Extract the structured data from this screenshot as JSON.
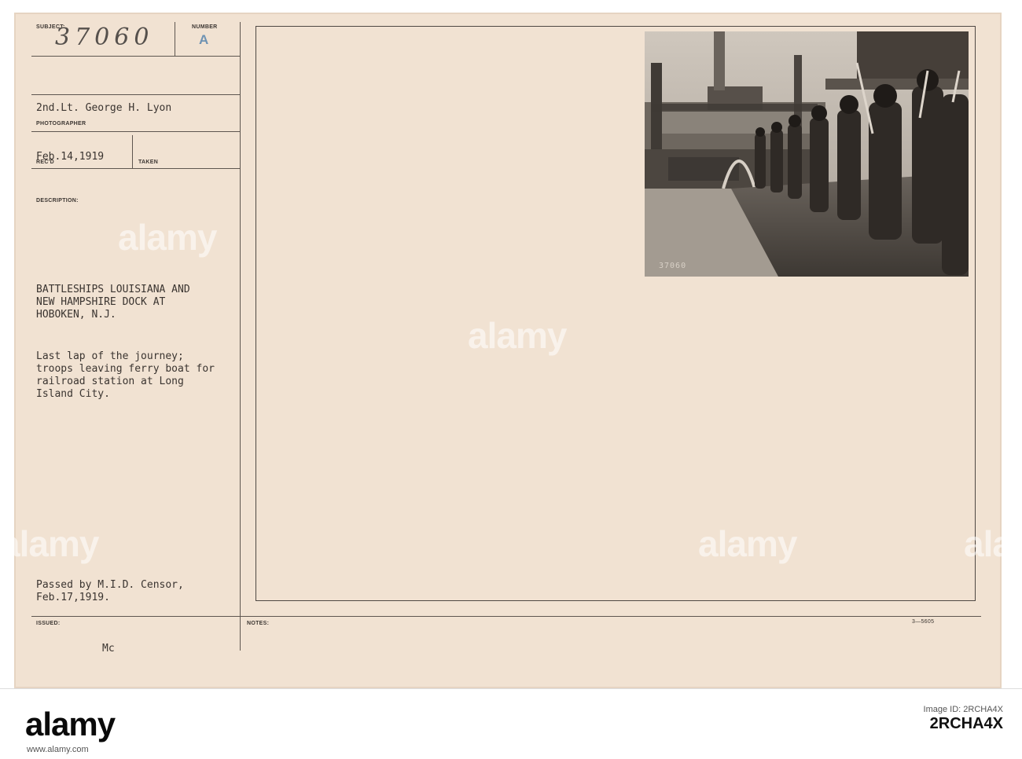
{
  "card": {
    "labels": {
      "subject": "SUBJECT:",
      "number": "NUMBER",
      "photographer": "PHOTOGRAPHER",
      "recd": "REC'D",
      "taken": "TAKEN",
      "description": "DESCRIPTION:",
      "issued": "ISSUED:",
      "notes": "NOTES:"
    },
    "subject_number": "37060",
    "number_letter": "A",
    "photographer": "2nd.Lt. George H. Lyon",
    "date_received": "Feb.14,1919",
    "description_title": "BATTLESHIPS LOUISIANA AND\nNEW HAMPSHIRE DOCK AT\nHOBOKEN, N.J.",
    "description_body": "Last lap of the journey;\ntroops leaving ferry boat for\nrailroad station at Long\nIsland City.",
    "censor": "Passed by M.I.D. Censor,\nFeb.17,1919.",
    "issued": "Mc",
    "form_code": "3—5605",
    "photo_number": "37060"
  },
  "watermark_text": "alamy",
  "footer": {
    "logo": "alamy",
    "image_id": "2RCHA4X",
    "caption": "Image ID: 2RCHA4X",
    "url": "www.alamy.com"
  }
}
